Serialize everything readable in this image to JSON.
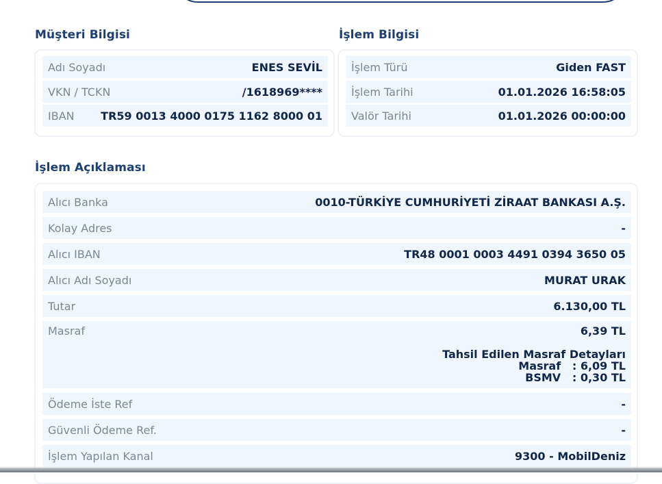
{
  "customer": {
    "title": "Müşteri Bilgisi",
    "rows": [
      {
        "label": "Adı Soyadı",
        "value": "ENES SEVİL"
      },
      {
        "label": "VKN / TCKN",
        "value": "/1618969****"
      },
      {
        "label": "IBAN",
        "value": "TR59 0013 4000 0175 1162 8000 01"
      }
    ]
  },
  "transaction": {
    "title": "İşlem Bilgisi",
    "rows": [
      {
        "label": "İşlem Türü",
        "value": "Giden FAST"
      },
      {
        "label": "İşlem Tarihi",
        "value": "01.01.2026 16:58:05"
      },
      {
        "label": "Valör Tarihi",
        "value": "01.01.2026 00:00:00"
      }
    ]
  },
  "description": {
    "title": "İşlem Açıklaması",
    "rows": [
      {
        "label": "Alıcı Banka",
        "value": "0010-TÜRKİYE CUMHURİYETİ ZİRAAT BANKASI A.Ş."
      },
      {
        "label": "Kolay Adres",
        "value": "-"
      },
      {
        "label": "Alıcı IBAN",
        "value": "TR48 0001 0003 4491 0394 3650 05"
      },
      {
        "label": "Alıcı Adı Soyadı",
        "value": "MURAT URAK"
      },
      {
        "label": "Tutar",
        "value": "6.130,00 TL"
      },
      {
        "label": "Masraf",
        "value": "6,39 TL"
      },
      {
        "label": "Ödeme İste Ref",
        "value": "-"
      },
      {
        "label": "Güvenli Ödeme Ref.",
        "value": "-"
      },
      {
        "label": "İşlem Yapılan Kanal",
        "value": "9300 - MobilDeniz"
      }
    ],
    "fee_details": {
      "heading": "Tahsil Edilen Masraf Detayları",
      "line1": "Masraf   : 6,09 TL",
      "line2": "BSMV   : 0,30 TL"
    }
  }
}
